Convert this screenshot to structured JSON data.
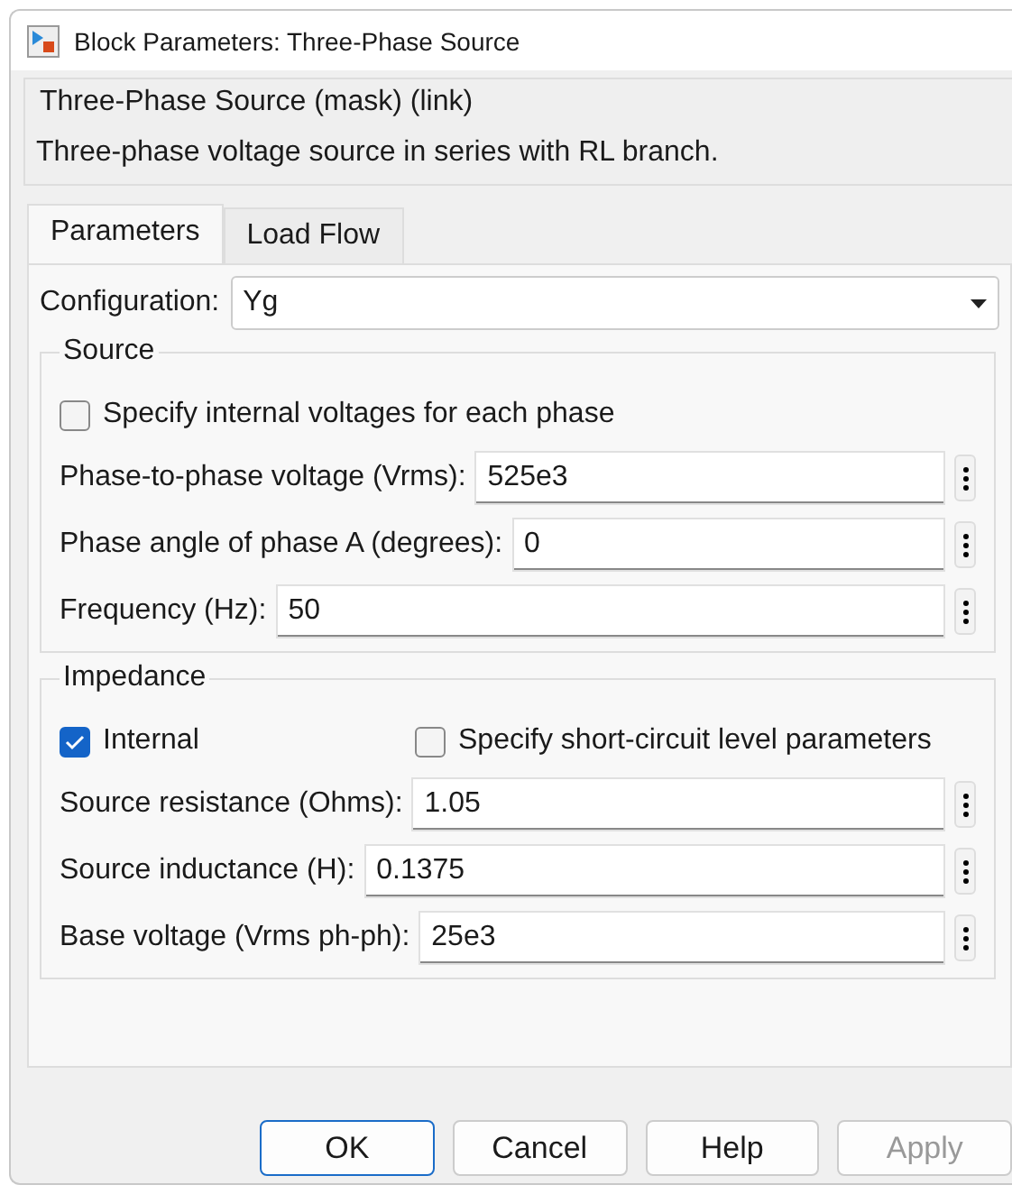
{
  "window": {
    "title": "Block Parameters: Three-Phase Source"
  },
  "mask": {
    "title": "Three-Phase Source (mask) (link)",
    "description": "Three-phase voltage source in series with RL branch."
  },
  "tabs": [
    {
      "label": "Parameters",
      "selected": true
    },
    {
      "label": "Load Flow",
      "selected": false
    }
  ],
  "configuration": {
    "label": "Configuration:",
    "value": "Yg"
  },
  "groups": [
    {
      "title": "Source",
      "rows": [
        {
          "kind": "checkbox",
          "items": [
            {
              "label": "Specify internal voltages for each phase",
              "checked": false
            }
          ]
        },
        {
          "kind": "field",
          "label": "Phase-to-phase voltage (Vrms):",
          "value": "525e3"
        },
        {
          "kind": "field",
          "label": "Phase angle of phase A (degrees):",
          "value": "0"
        },
        {
          "kind": "field",
          "label": "Frequency (Hz):",
          "value": "50"
        }
      ]
    },
    {
      "title": "Impedance",
      "rows": [
        {
          "kind": "checkbox",
          "items": [
            {
              "label": "Internal",
              "checked": true
            },
            {
              "label": "Specify short-circuit level parameters",
              "checked": false
            }
          ]
        },
        {
          "kind": "field",
          "label": "Source resistance (Ohms):",
          "value": "1.05"
        },
        {
          "kind": "field",
          "label": "Source inductance (H):",
          "value": "0.1375"
        },
        {
          "kind": "field",
          "label": "Base voltage (Vrms ph-ph):",
          "value": "25e3"
        }
      ]
    }
  ],
  "buttons": [
    {
      "label": "OK",
      "disabled": false,
      "default": true
    },
    {
      "label": "Cancel",
      "disabled": false,
      "default": false
    },
    {
      "label": "Help",
      "disabled": false,
      "default": false
    },
    {
      "label": "Apply",
      "disabled": true,
      "default": false
    }
  ]
}
